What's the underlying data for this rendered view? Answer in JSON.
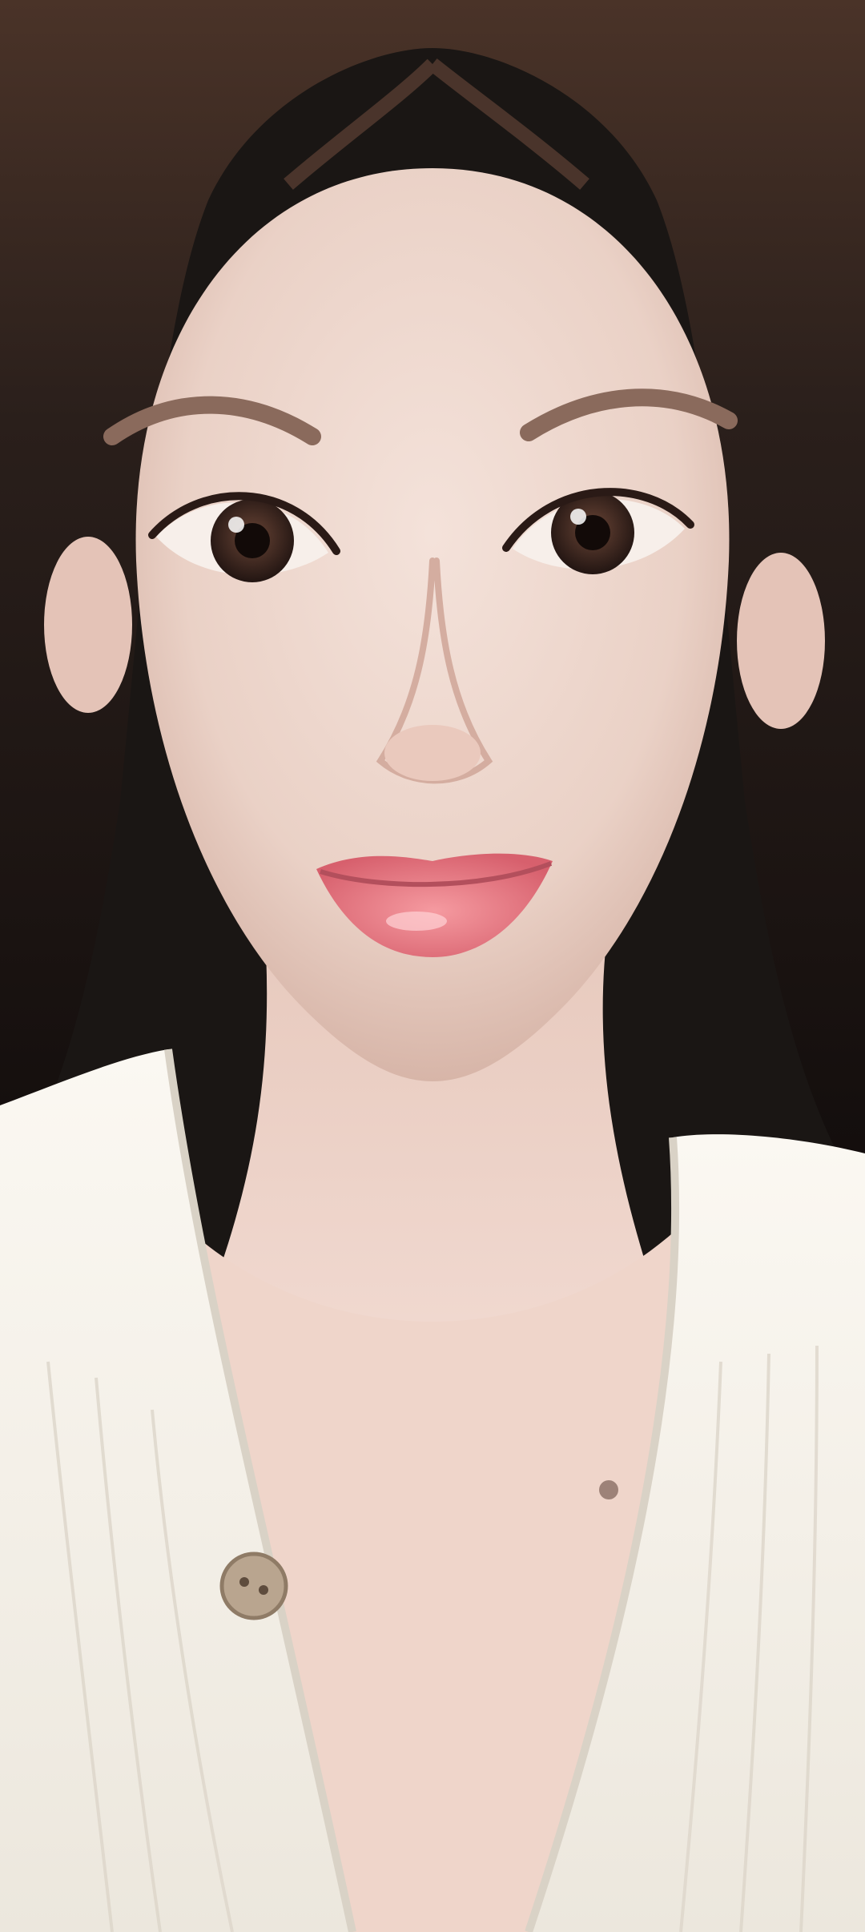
{
  "photo": {
    "subject": "portrait-selfie",
    "palette": {
      "hair": "#2a1f1b",
      "hair_highlight": "#6b4a3a",
      "skin": "#f0d8cf",
      "skin_shadow": "#d9b7ab",
      "lips": "#e07a83",
      "eye_iris": "#3b2620",
      "blouse": "#f6f2ea",
      "blouse_shadow": "#dcd6cb",
      "button": "#b9a58f",
      "background": "#1a1614"
    }
  }
}
